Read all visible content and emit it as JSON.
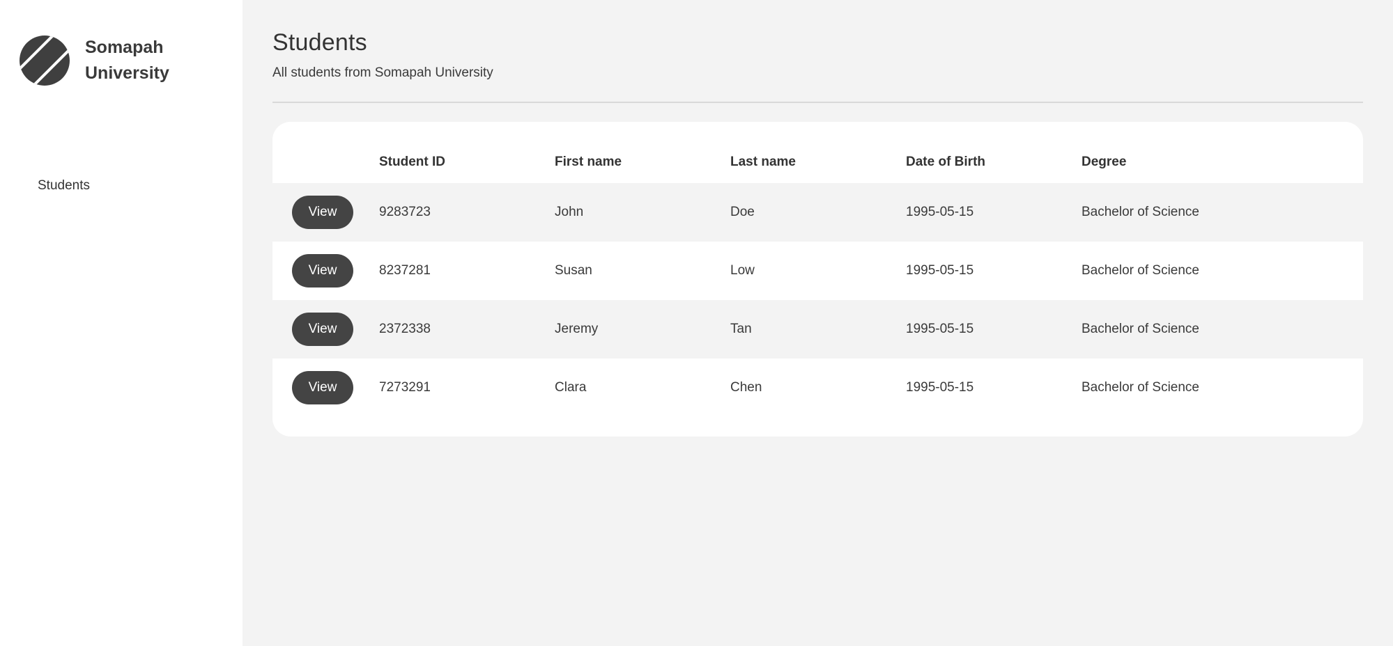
{
  "brand": {
    "logo_icon": "striped-circle-logo",
    "name_line1": "Somapah",
    "name_line2": "University"
  },
  "sidebar": {
    "items": [
      {
        "label": "Students"
      }
    ]
  },
  "header": {
    "title": "Students",
    "subtitle": "All students from Somapah University"
  },
  "table": {
    "columns": [
      "",
      "Student ID",
      "First name",
      "Last name",
      "Date of Birth",
      "Degree"
    ],
    "view_label": "View",
    "rows": [
      {
        "student_id": "9283723",
        "first_name": "John",
        "last_name": "Doe",
        "dob": "1995-05-15",
        "degree": "Bachelor of Science"
      },
      {
        "student_id": "8237281",
        "first_name": "Susan",
        "last_name": "Low",
        "dob": "1995-05-15",
        "degree": "Bachelor of Science"
      },
      {
        "student_id": "2372338",
        "first_name": "Jeremy",
        "last_name": "Tan",
        "dob": "1995-05-15",
        "degree": "Bachelor of Science"
      },
      {
        "student_id": "7273291",
        "first_name": "Clara",
        "last_name": "Chen",
        "dob": "1995-05-15",
        "degree": "Bachelor of Science"
      }
    ]
  },
  "colors": {
    "sidebar_bg": "#ffffff",
    "page_bg": "#f3f3f3",
    "button_bg": "#444444",
    "text": "#3a3a3a"
  }
}
